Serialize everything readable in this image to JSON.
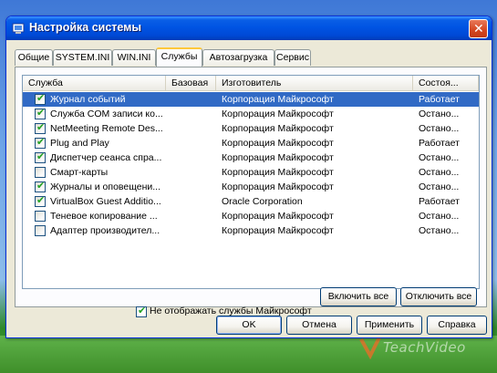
{
  "window": {
    "title": "Настройка системы"
  },
  "tabs": [
    "Общие",
    "SYSTEM.INI",
    "WIN.INI",
    "Службы",
    "Автозагрузка",
    "Сервис"
  ],
  "active_tab_index": 3,
  "columns": [
    "Служба",
    "Базовая",
    "Изготовитель",
    "Состоя..."
  ],
  "services": [
    {
      "name": "Журнал событий",
      "base": "",
      "vendor": "Корпорация Майкрософт",
      "status": "Работает",
      "checked": true,
      "selected": true
    },
    {
      "name": "Служба COM записи ко...",
      "base": "",
      "vendor": "Корпорация Майкрософт",
      "status": "Остано...",
      "checked": true,
      "selected": false
    },
    {
      "name": "NetMeeting Remote Des...",
      "base": "",
      "vendor": "Корпорация Майкрософт",
      "status": "Остано...",
      "checked": true,
      "selected": false
    },
    {
      "name": "Plug and Play",
      "base": "",
      "vendor": "Корпорация Майкрософт",
      "status": "Работает",
      "checked": true,
      "selected": false
    },
    {
      "name": "Диспетчер сеанса спра...",
      "base": "",
      "vendor": "Корпорация Майкрософт",
      "status": "Остано...",
      "checked": true,
      "selected": false
    },
    {
      "name": "Смарт-карты",
      "base": "",
      "vendor": "Корпорация Майкрософт",
      "status": "Остано...",
      "checked": false,
      "selected": false
    },
    {
      "name": "Журналы и оповещени...",
      "base": "",
      "vendor": "Корпорация Майкрософт",
      "status": "Остано...",
      "checked": true,
      "selected": false
    },
    {
      "name": "VirtualBox Guest Additio...",
      "base": "",
      "vendor": "Oracle Corporation",
      "status": "Работает",
      "checked": true,
      "selected": false
    },
    {
      "name": "Теневое копирование ...",
      "base": "",
      "vendor": "Корпорация Майкрософт",
      "status": "Остано...",
      "checked": false,
      "selected": false
    },
    {
      "name": "Адаптер производител...",
      "base": "",
      "vendor": "Корпорация Майкрософт",
      "status": "Остано...",
      "checked": false,
      "selected": false
    }
  ],
  "hide_ms_services": {
    "label": "Не отображать службы Майкрософт",
    "checked": true
  },
  "buttons": {
    "enable_all": "Включить все",
    "disable_all": "Отключить все",
    "ok": "OK",
    "cancel": "Отмена",
    "apply": "Применить",
    "help": "Справка"
  },
  "watermark": "TeachVideo"
}
